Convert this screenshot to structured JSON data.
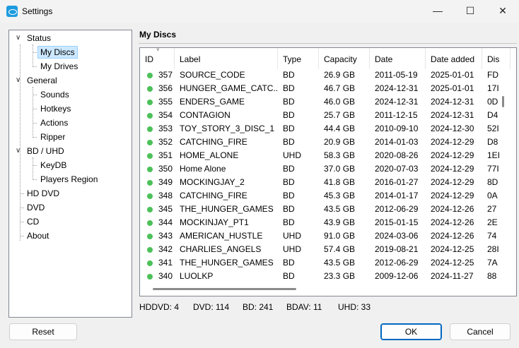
{
  "window": {
    "title": "Settings"
  },
  "tree": [
    {
      "label": "Status",
      "level": 0,
      "expanded": true
    },
    {
      "label": "My Discs",
      "level": 1,
      "selected": true
    },
    {
      "label": "My Drives",
      "level": 1
    },
    {
      "label": "General",
      "level": 0,
      "expanded": true
    },
    {
      "label": "Sounds",
      "level": 1
    },
    {
      "label": "Hotkeys",
      "level": 1
    },
    {
      "label": "Actions",
      "level": 1
    },
    {
      "label": "Ripper",
      "level": 1
    },
    {
      "label": "BD / UHD",
      "level": 0,
      "expanded": true
    },
    {
      "label": "KeyDB",
      "level": 1
    },
    {
      "label": "Players Region",
      "level": 1
    },
    {
      "label": "HD DVD",
      "level": 0
    },
    {
      "label": "DVD",
      "level": 0
    },
    {
      "label": "CD",
      "level": 0
    },
    {
      "label": "About",
      "level": 0
    }
  ],
  "panel": {
    "heading": "My Discs"
  },
  "table": {
    "columns": [
      "ID",
      "Label",
      "Type",
      "Capacity",
      "Date",
      "Date added",
      "Dis"
    ],
    "status_color": "#4cc159",
    "rows": [
      [
        "357",
        "SOURCE_CODE",
        "BD",
        "26.9 GB",
        "2011-05-19",
        "2025-01-01",
        "FD"
      ],
      [
        "356",
        "HUNGER_GAME_CATC...",
        "BD",
        "46.7 GB",
        "2024-12-31",
        "2025-01-01",
        "17I"
      ],
      [
        "355",
        "ENDERS_GAME",
        "BD",
        "46.0 GB",
        "2024-12-31",
        "2024-12-31",
        "0D"
      ],
      [
        "354",
        "CONTAGION",
        "BD",
        "25.7 GB",
        "2011-12-15",
        "2024-12-31",
        "D4"
      ],
      [
        "353",
        "TOY_STORY_3_DISC_1",
        "BD",
        "44.4 GB",
        "2010-09-10",
        "2024-12-30",
        "52I"
      ],
      [
        "352",
        "CATCHING_FIRE",
        "BD",
        "20.9 GB",
        "2014-01-03",
        "2024-12-29",
        "D8"
      ],
      [
        "351",
        "HOME_ALONE",
        "UHD",
        "58.3 GB",
        "2020-08-26",
        "2024-12-29",
        "1EI"
      ],
      [
        "350",
        "Home Alone",
        "BD",
        "37.0 GB",
        "2020-07-03",
        "2024-12-29",
        "77I"
      ],
      [
        "349",
        "MOCKINGJAY_2",
        "BD",
        "41.8 GB",
        "2016-01-27",
        "2024-12-29",
        "8D"
      ],
      [
        "348",
        "CATCHING_FIRE",
        "BD",
        "45.3 GB",
        "2014-01-17",
        "2024-12-29",
        "0A"
      ],
      [
        "345",
        "THE_HUNGER_GAMES",
        "BD",
        "43.5 GB",
        "2012-06-29",
        "2024-12-26",
        "27"
      ],
      [
        "344",
        "MOCKINJAY_PT1",
        "BD",
        "43.9 GB",
        "2015-01-15",
        "2024-12-26",
        "2E"
      ],
      [
        "343",
        "AMERICAN_HUSTLE",
        "UHD",
        "91.0 GB",
        "2024-03-06",
        "2024-12-26",
        "74"
      ],
      [
        "342",
        "CHARLIES_ANGELS",
        "UHD",
        "57.4 GB",
        "2019-08-21",
        "2024-12-25",
        "28I"
      ],
      [
        "341",
        "THE_HUNGER_GAMES",
        "BD",
        "43.5 GB",
        "2012-06-29",
        "2024-12-25",
        "7A"
      ],
      [
        "340",
        "LUOLKP",
        "BD",
        "23.3 GB",
        "2009-12-06",
        "2024-11-27",
        "88"
      ]
    ]
  },
  "status": [
    "HDDVD: 4",
    "DVD: 114",
    "BD: 241",
    "BDAV: 11",
    "UHD: 33"
  ],
  "buttons": {
    "reset": "Reset",
    "ok": "OK",
    "cancel": "Cancel"
  }
}
